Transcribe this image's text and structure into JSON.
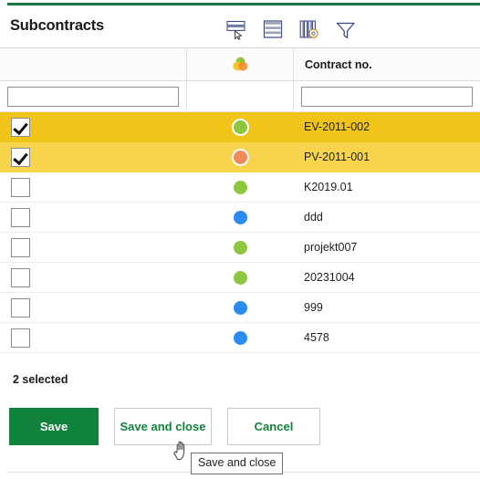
{
  "accent_color": "#1b7a43",
  "header": {
    "title": "Subcontracts",
    "toolbar": [
      {
        "name": "select-rows-icon",
        "label": "Select rows"
      },
      {
        "name": "list-view-icon",
        "label": "List view"
      },
      {
        "name": "column-settings-icon",
        "label": "Column settings"
      },
      {
        "name": "filter-funnel-icon",
        "label": "Filter"
      }
    ]
  },
  "grid": {
    "columns": [
      {
        "key": "checkbox",
        "header": ""
      },
      {
        "key": "status",
        "header": "",
        "icon": "status-circles-icon"
      },
      {
        "key": "contract_no",
        "header": "Contract no."
      }
    ],
    "filters": {
      "checkbox_filter_value": "",
      "checkbox_filter_placeholder": "",
      "contract_filter_value": "",
      "contract_filter_placeholder": ""
    },
    "rows": [
      {
        "checked": true,
        "selection": "primary",
        "status_color": "#8ec63f",
        "contract_no": "EV-2011-002"
      },
      {
        "checked": true,
        "selection": "secondary",
        "status_color": "#f08a5d",
        "contract_no": "PV-2011-001"
      },
      {
        "checked": false,
        "selection": "none",
        "status_color": "#8ec63f",
        "contract_no": "K2019.01"
      },
      {
        "checked": false,
        "selection": "none",
        "status_color": "#2a8cf0",
        "contract_no": "ddd"
      },
      {
        "checked": false,
        "selection": "none",
        "status_color": "#8ec63f",
        "contract_no": "projekt007"
      },
      {
        "checked": false,
        "selection": "none",
        "status_color": "#8ec63f",
        "contract_no": "20231004"
      },
      {
        "checked": false,
        "selection": "none",
        "status_color": "#2a8cf0",
        "contract_no": "999"
      },
      {
        "checked": false,
        "selection": "none",
        "status_color": "#2a8cf0",
        "contract_no": "4578"
      }
    ],
    "row_colors": {
      "primary": "#f0c419",
      "secondary": "#f7d44c"
    }
  },
  "footer": {
    "selected_count_text": "2 selected",
    "buttons": {
      "save": "Save",
      "save_and_close": "Save and close",
      "cancel": "Cancel"
    }
  },
  "tooltip": {
    "text": "Save and close"
  }
}
